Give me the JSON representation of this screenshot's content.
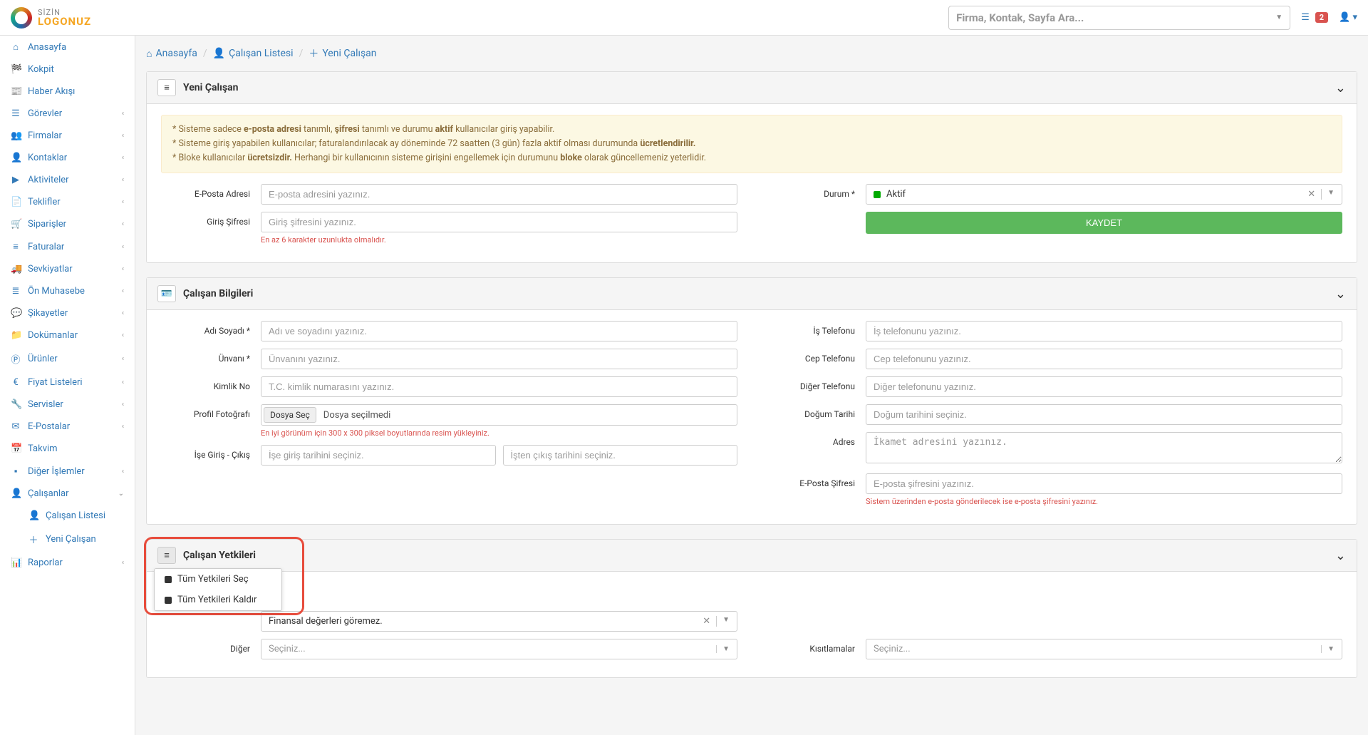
{
  "logo": {
    "line1": "SİZİN",
    "line2": "LOGONUZ"
  },
  "search": {
    "placeholder": "Firma, Kontak, Sayfa Ara..."
  },
  "notif_count": "2",
  "sidebar": {
    "items": [
      {
        "icon": "⌂",
        "label": "Anasayfa",
        "chev": false
      },
      {
        "icon": "🏁",
        "label": "Kokpit",
        "chev": false
      },
      {
        "icon": "📰",
        "label": "Haber Akışı",
        "chev": false
      },
      {
        "icon": "☰",
        "label": "Görevler",
        "chev": true
      },
      {
        "icon": "👥",
        "label": "Firmalar",
        "chev": true
      },
      {
        "icon": "👤",
        "label": "Kontaklar",
        "chev": true
      },
      {
        "icon": "▶",
        "label": "Aktiviteler",
        "chev": true
      },
      {
        "icon": "📄",
        "label": "Teklifler",
        "chev": true
      },
      {
        "icon": "🛒",
        "label": "Siparişler",
        "chev": true
      },
      {
        "icon": "≡",
        "label": "Faturalar",
        "chev": true
      },
      {
        "icon": "🚚",
        "label": "Sevkiyatlar",
        "chev": true
      },
      {
        "icon": "≣",
        "label": "Ön Muhasebe",
        "chev": true
      },
      {
        "icon": "💬",
        "label": "Şikayetler",
        "chev": true
      },
      {
        "icon": "📁",
        "label": "Dokümanlar",
        "chev": true
      },
      {
        "icon": "Ⓟ",
        "label": "Ürünler",
        "chev": true
      },
      {
        "icon": "€",
        "label": "Fiyat Listeleri",
        "chev": true
      },
      {
        "icon": "🔧",
        "label": "Servisler",
        "chev": true
      },
      {
        "icon": "✉",
        "label": "E-Postalar",
        "chev": true
      },
      {
        "icon": "📅",
        "label": "Takvim",
        "chev": false
      },
      {
        "icon": "▪",
        "label": "Diğer İşlemler",
        "chev": true
      },
      {
        "icon": "👤",
        "label": "Çalışanlar",
        "chev": true,
        "open": true
      },
      {
        "icon": "👤",
        "label": "Çalışan Listesi",
        "sub": true
      },
      {
        "icon": "＋",
        "label": "Yeni Çalışan",
        "sub": true
      },
      {
        "icon": "📊",
        "label": "Raporlar",
        "chev": true
      }
    ]
  },
  "breadcrumb": {
    "home": "Anasayfa",
    "list": "Çalışan Listesi",
    "new": "Yeni Çalışan"
  },
  "panel1": {
    "title": "Yeni Çalışan",
    "alert": {
      "l1a": "* Sisteme sadece ",
      "l1b": "e-posta adresi",
      "l1c": " tanımlı, ",
      "l1d": "şifresi",
      "l1e": " tanımlı ve durumu ",
      "l1f": "aktif",
      "l1g": " kullanıcılar giriş yapabilir.",
      "l2a": "* Sisteme giriş yapabilen kullanıcılar; faturalandırılacak ay döneminde 72 saatten (3 gün) fazla aktif olması durumunda ",
      "l2b": "ücretlendirilir.",
      "l3a": "* Bloke kullanıcılar ",
      "l3b": "ücretsizdir.",
      "l3c": " Herhangi bir kullanıcının sisteme girişini engellemek için durumunu ",
      "l3d": "bloke",
      "l3e": " olarak güncellemeniz yeterlidir."
    },
    "email_label": "E-Posta Adresi",
    "email_placeholder": "E-posta adresini yazınız.",
    "pass_label": "Giriş Şifresi",
    "pass_placeholder": "Giriş şifresini yazınız.",
    "pass_help": "En az 6 karakter uzunlukta olmalıdır.",
    "status_label": "Durum *",
    "status_value": "Aktif",
    "save_btn": "KAYDET"
  },
  "panel2": {
    "title": "Çalışan Bilgileri",
    "name_label": "Adı Soyadı *",
    "name_ph": "Adı ve soyadını yazınız.",
    "title_label": "Ünvanı *",
    "title_ph": "Ünvanını yazınız.",
    "id_label": "Kimlik No",
    "id_ph": "T.C. kimlik numarasını yazınız.",
    "photo_label": "Profil Fotoğrafı",
    "photo_btn": "Dosya Seç",
    "photo_none": "Dosya seçilmedi",
    "photo_help": "En iyi görünüm için 300 x 300 piksel boyutlarında resim yükleyiniz.",
    "dates_label": "İşe Giriş - Çıkış",
    "date_in_ph": "İşe giriş tarihini seçiniz.",
    "date_out_ph": "İşten çıkış tarihini seçiniz.",
    "work_phone_label": "İş Telefonu",
    "work_phone_ph": "İş telefonunu yazınız.",
    "cell_label": "Cep Telefonu",
    "cell_ph": "Cep telefonunu yazınız.",
    "other_phone_label": "Diğer Telefonu",
    "other_phone_ph": "Diğer telefonunu yazınız.",
    "birth_label": "Doğum Tarihi",
    "birth_ph": "Doğum tarihini seçiniz.",
    "addr_label": "Adres",
    "addr_ph": "İkamet adresini yazınız.",
    "epass_label": "E-Posta Şifresi",
    "epass_ph": "E-posta şifresini yazınız.",
    "epass_help": "Sistem üzerinden e-posta gönderilecek ise e-posta şifresini yazınız."
  },
  "panel3": {
    "title": "Çalışan Yetkileri",
    "menu_all": "Tüm Yetkileri Seç",
    "menu_none": "Tüm Yetkileri Kaldır",
    "fin_value": "Finansal değerleri göremez.",
    "other_label": "Diğer",
    "other_ph": "Seçiniz...",
    "restrict_label": "Kısıtlamalar",
    "restrict_ph": "Seçiniz..."
  }
}
